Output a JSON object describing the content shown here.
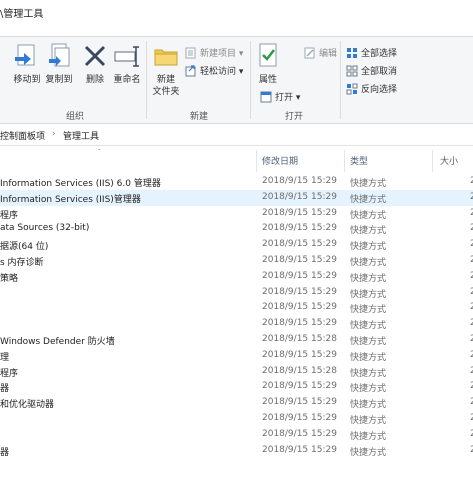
{
  "window": {
    "title": "\\管理工具"
  },
  "ribbon": {
    "organize": {
      "label": "组织",
      "move_to": "移动到",
      "copy_to": "复制到",
      "delete": "删除",
      "rename": "重命名"
    },
    "new": {
      "label": "新建",
      "new_folder_line1": "新建",
      "new_folder_line2": "文件夹",
      "new_item": "新建项目 ▾",
      "easy_access": "轻松访问 ▾"
    },
    "open": {
      "label": "打开",
      "properties": "属性",
      "open": "打开 ▾",
      "edit": "编辑"
    },
    "select": {
      "select_all": "全部选择",
      "select_none": "全部取消",
      "invert_selection": "反向选择"
    }
  },
  "address": {
    "crumb1": "控制面板项",
    "separator": "›",
    "crumb2": "管理工具"
  },
  "columns": {
    "sort_indicator": "^",
    "date": "修改日期",
    "type": "类型",
    "size": "大小"
  },
  "files": [
    {
      "name": "Information Services (IIS) 6.0 管理器",
      "date": "2018/9/15 15:29",
      "type": "快捷方式",
      "size": "2",
      "selected": false
    },
    {
      "name": "Information Services (IIS)管理器",
      "date": "2018/9/15 15:29",
      "type": "快捷方式",
      "size": "2",
      "selected": true
    },
    {
      "name": "程序",
      "date": "2018/9/15 15:29",
      "type": "快捷方式",
      "size": "2",
      "selected": false
    },
    {
      "name": "ata Sources (32-bit)",
      "date": "2018/9/15 15:29",
      "type": "快捷方式",
      "size": "2",
      "selected": false
    },
    {
      "name": "据源(64 位)",
      "date": "2018/9/15 15:29",
      "type": "快捷方式",
      "size": "2",
      "selected": false
    },
    {
      "name": "s 内存诊断",
      "date": "2018/9/15 15:29",
      "type": "快捷方式",
      "size": "2",
      "selected": false
    },
    {
      "name": "策略",
      "date": "2018/9/15 15:29",
      "type": "快捷方式",
      "size": "2",
      "selected": false
    },
    {
      "name": "",
      "date": "2018/9/15 15:29",
      "type": "快捷方式",
      "size": "2",
      "selected": false
    },
    {
      "name": "",
      "date": "2018/9/15 15:29",
      "type": "快捷方式",
      "size": "2",
      "selected": false
    },
    {
      "name": "",
      "date": "2018/9/15 15:29",
      "type": "快捷方式",
      "size": "2",
      "selected": false
    },
    {
      "name": "Windows Defender 防火墙",
      "date": "2018/9/15 15:28",
      "type": "快捷方式",
      "size": "2",
      "selected": false
    },
    {
      "name": "理",
      "date": "2018/9/15 15:29",
      "type": "快捷方式",
      "size": "2",
      "selected": false
    },
    {
      "name": "程序",
      "date": "2018/9/15 15:28",
      "type": "快捷方式",
      "size": "2",
      "selected": false
    },
    {
      "name": "器",
      "date": "2018/9/15 15:29",
      "type": "快捷方式",
      "size": "2",
      "selected": false
    },
    {
      "name": "和优化驱动器",
      "date": "2018/9/15 15:29",
      "type": "快捷方式",
      "size": "2",
      "selected": false
    },
    {
      "name": "",
      "date": "2018/9/15 15:29",
      "type": "快捷方式",
      "size": "2",
      "selected": false
    },
    {
      "name": "",
      "date": "2018/9/15 15:29",
      "type": "快捷方式",
      "size": "2",
      "selected": false
    },
    {
      "name": "器",
      "date": "2018/9/15 15:29",
      "type": "快捷方式",
      "size": "2",
      "selected": false
    }
  ]
}
